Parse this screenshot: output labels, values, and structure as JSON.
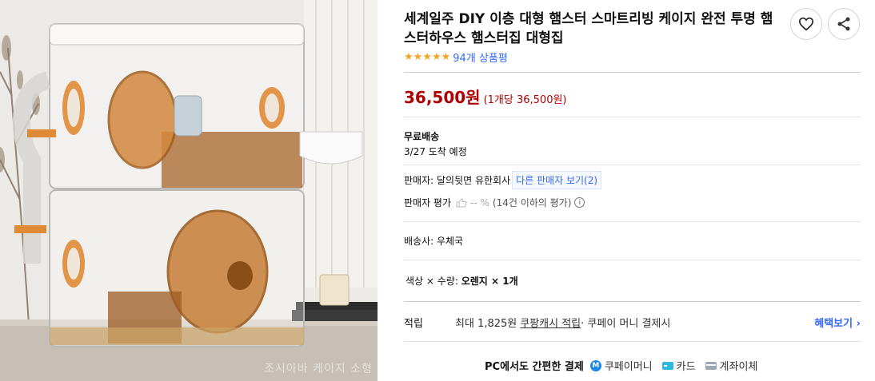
{
  "product": {
    "title": "세계일주 DIY 이층 대형 햄스터 스마트리빙 케이지 완전 투명 햄스터하우스 햄스터집 대형집",
    "image_watermark": "조시아바 케이지 소형",
    "rating_stars": 5,
    "review_count_text": "94개 상품평",
    "price": "36,500원",
    "unit_price": "(1개당 36,500원)"
  },
  "shipping": {
    "title": "무료배송",
    "date": "3/27 도착 예정"
  },
  "seller": {
    "label_name": "판매자: 달의뒷면 유한회사",
    "other_sellers": "다른 판매자 보기(2)",
    "rating_label": "판매자 평가",
    "rating_value": "-- %",
    "rating_note": "(14건 이하의 평가)"
  },
  "courier": "배송사: 우체국",
  "option": {
    "label": "색상 × 수량:",
    "value": "오렌지 × 1개"
  },
  "benefit": {
    "label": "적립",
    "text_prefix": "최대 1,825원 ",
    "link": "쿠팡캐시 적립",
    "text_suffix": " · 쿠페이 머니 결제시",
    "more": "혜택보기 ›"
  },
  "payment": {
    "title": "PC에서도 간편한 결제",
    "icon_m": "M",
    "money": "쿠페이머니",
    "card": "카드",
    "bank": "계좌이체"
  },
  "icons": {
    "like": "heart-icon",
    "share": "share-icon",
    "info": "info-icon"
  },
  "colors": {
    "price_red": "#ae0000",
    "link_blue": "#346aff",
    "star": "#f5a623"
  }
}
